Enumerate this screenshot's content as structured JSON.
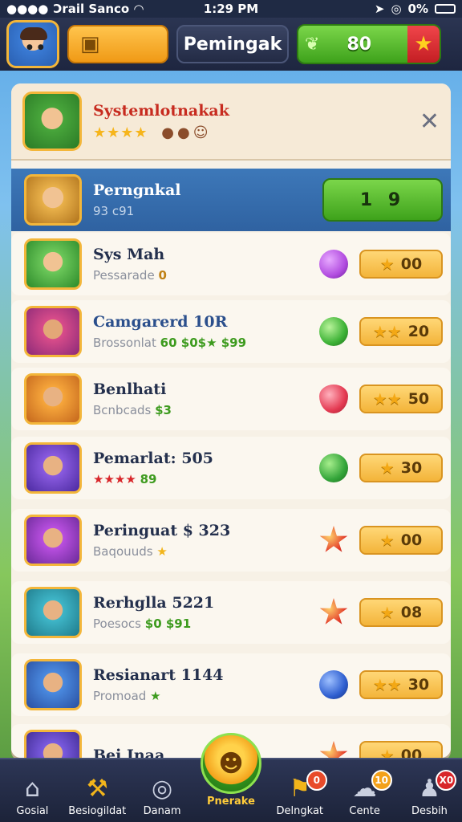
{
  "status_bar": {
    "carrier": "Ɔrail Sanco",
    "time": "1:29 PM",
    "battery": "0%"
  },
  "top_bar": {
    "title": "Pemingak",
    "currency_value": "80"
  },
  "panel": {
    "header_title": "Systemlotnakak",
    "header_stars": "★★★★",
    "selected_row": {
      "name": "Perngnkal",
      "sub": "93 c91",
      "button": "1 9"
    },
    "rows": [
      {
        "name": "Sys Mah",
        "sub_text": "Pessarade",
        "sub_hl": "0",
        "gem_color": "#b24de0",
        "pill_stars": "★",
        "pill_value": "00"
      },
      {
        "name": "Camgarerd 10R",
        "sub_text": "Brossonlat",
        "sub_hl": "60 $0$★ $99",
        "gem_color": "#3db236",
        "pill_stars": "★★",
        "pill_value": "20"
      },
      {
        "name": "Benlhati",
        "sub_text": "Bcnbcads",
        "sub_hl": "$3",
        "gem_color": "#e43a52",
        "pill_stars": "★★",
        "pill_value": "50"
      },
      {
        "name": "Pemarlat: 505",
        "sub_text": "",
        "sub_hl": "89",
        "sub_stars": "★★★★",
        "gem_color": "#34a53a",
        "pill_stars": "★",
        "pill_value": "30"
      },
      {
        "name": "Peringuat $ 323",
        "sub_text": "Baqouuds",
        "sub_hl": "",
        "sub_star": "★",
        "gem_color": "#e33a2a",
        "pill_stars": "★",
        "pill_value": "00"
      },
      {
        "name": "Rerhglla 5221",
        "sub_text": "Poesocs",
        "sub_hl": "$0 $91",
        "gem_color": "#e33a2a",
        "pill_stars": "★",
        "pill_value": "08"
      },
      {
        "name": "Resianart 1144",
        "sub_text": "Promoad",
        "sub_hl": "",
        "sub_star": "★",
        "gem_color": "#2f5fd0",
        "pill_stars": "★★",
        "pill_value": "30"
      },
      {
        "name": "Bei Inaa",
        "sub_text": "",
        "sub_hl": "",
        "gem_color": "#e33a2a",
        "pill_stars": "★",
        "pill_value": "00"
      }
    ]
  },
  "bottom_nav": {
    "items": [
      {
        "label": "Gosial"
      },
      {
        "label": "Besiogildat"
      },
      {
        "label": "Danam"
      },
      {
        "label": "Pnerake"
      },
      {
        "label": "Delngkat",
        "badge": "0"
      },
      {
        "label": "Cente",
        "badge": "10"
      },
      {
        "label": "Desbih",
        "badge": "X0"
      }
    ]
  }
}
